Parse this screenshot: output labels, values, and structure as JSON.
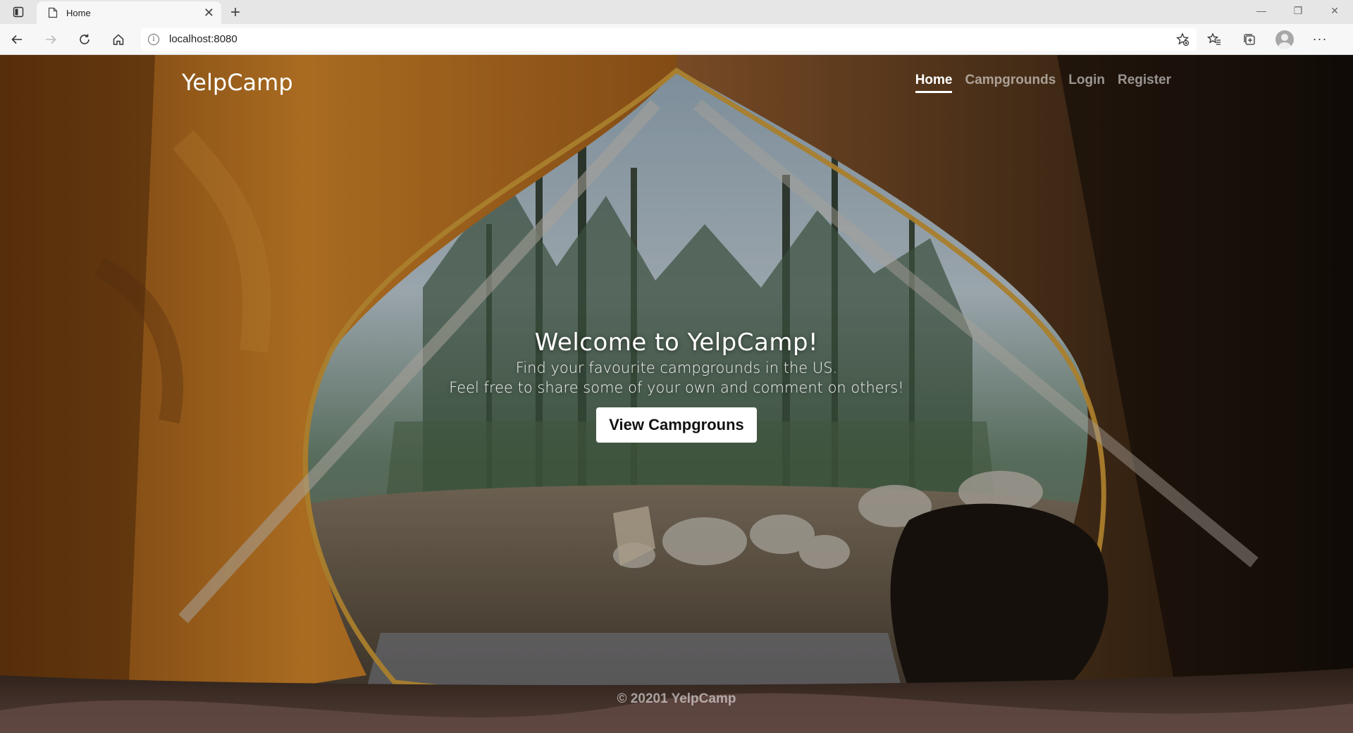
{
  "browser": {
    "tab_title": "Home",
    "new_tab_icon": "plus-icon",
    "url": "localhost:8080"
  },
  "site": {
    "brand": "YelpCamp",
    "nav": [
      {
        "label": "Home",
        "active": true
      },
      {
        "label": "Campgrounds",
        "active": false
      },
      {
        "label": "Login",
        "active": false
      },
      {
        "label": "Register",
        "active": false
      }
    ]
  },
  "hero": {
    "title": "Welcome to YelpCamp!",
    "line1": "Find your favourite campgrounds in the US.",
    "line2": "Feel free to share some of your own and comment on others!",
    "cta_label": "View Campgrouns"
  },
  "footer": {
    "text": "© 20201 YelpCamp"
  },
  "colors": {
    "tent_orange": "#c8741c",
    "tent_dark": "#2a1c10",
    "forest": "#3e5a3a",
    "sky": "#b8c8d8"
  }
}
